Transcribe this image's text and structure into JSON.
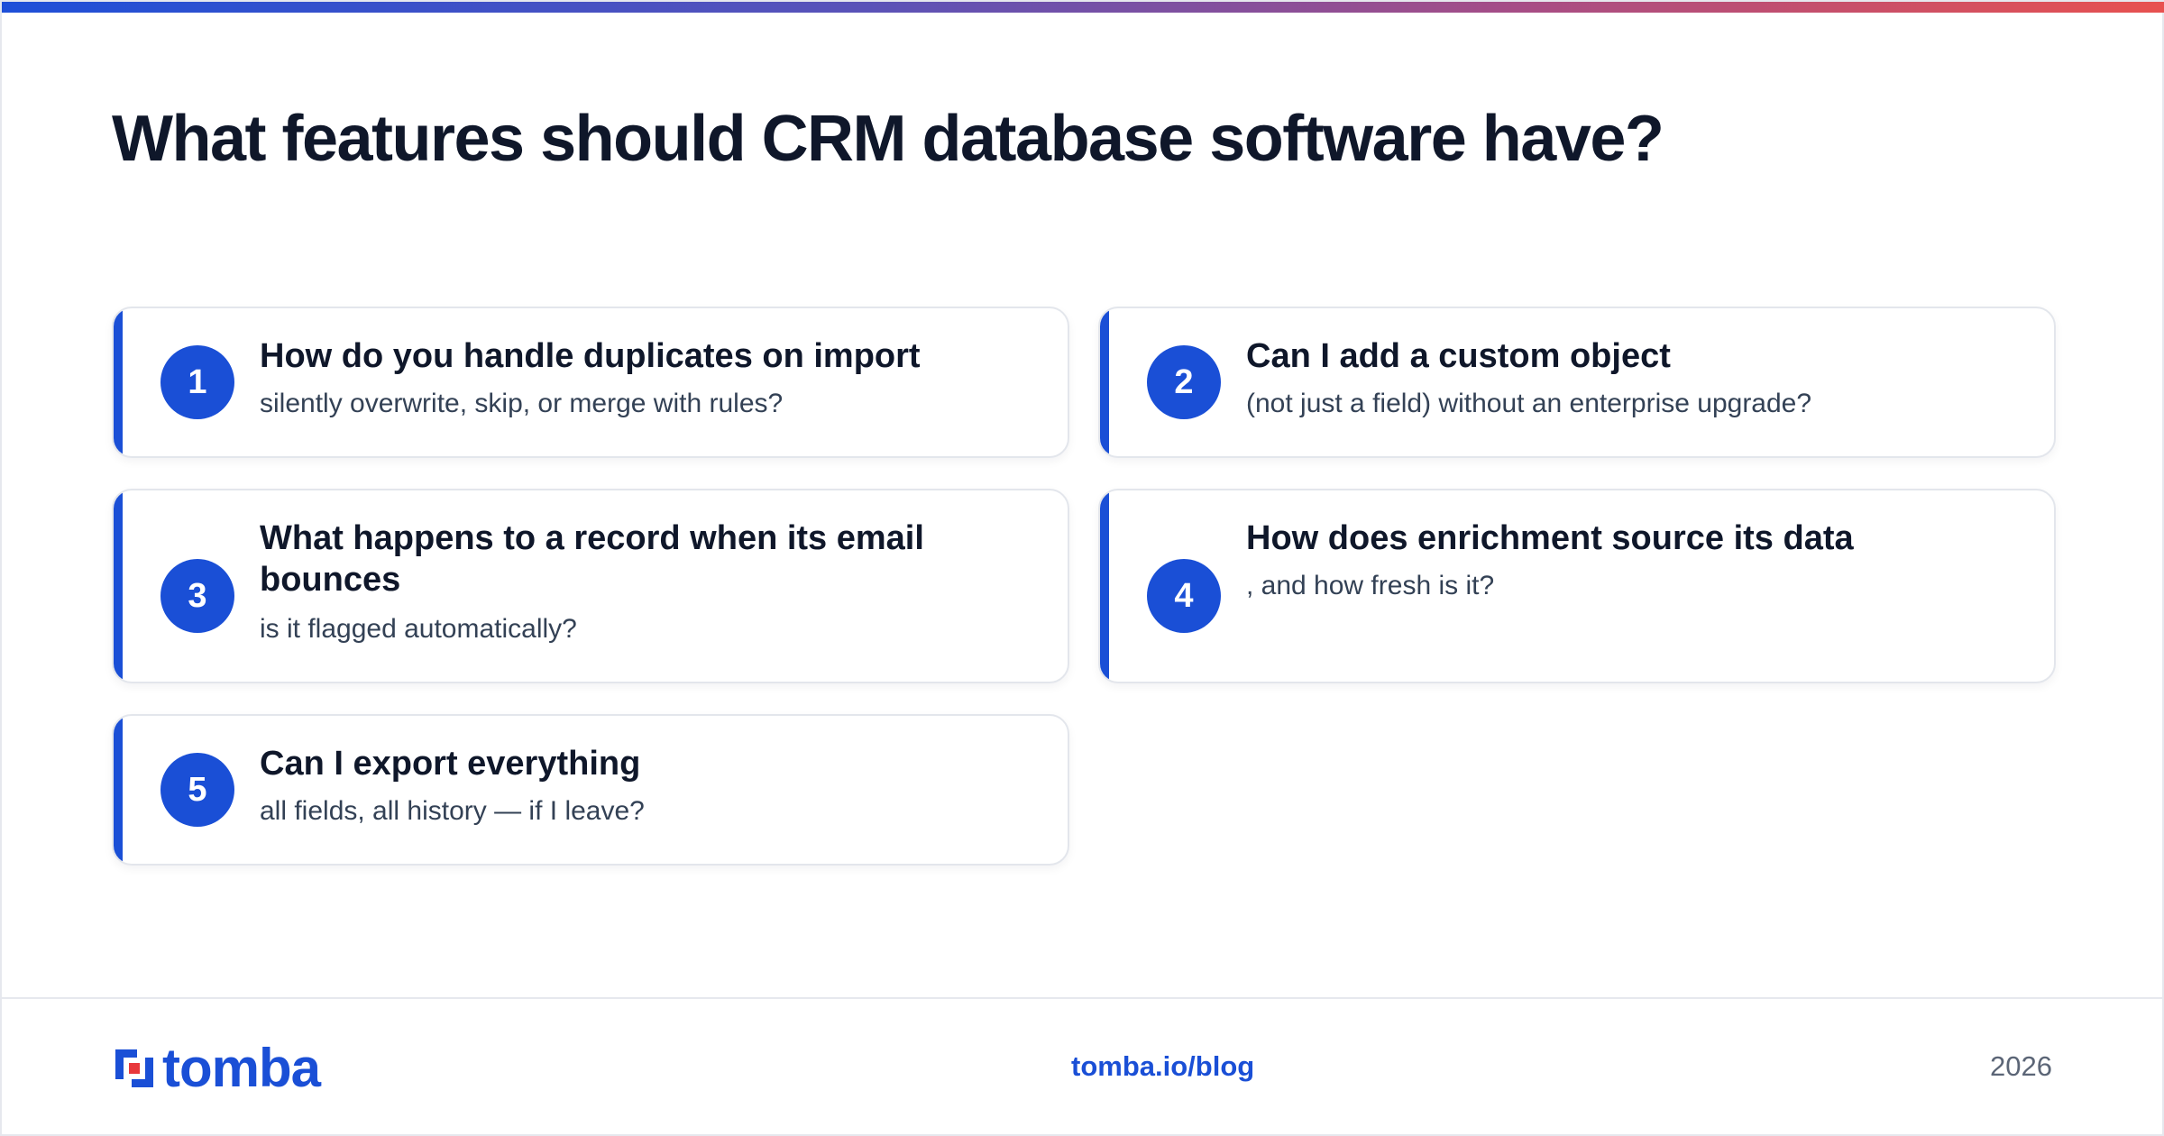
{
  "title": "What features should CRM database software have?",
  "cards": [
    {
      "number": "1",
      "title": "How do you handle duplicates on import",
      "subtitle": "silently overwrite, skip, or merge with rules?"
    },
    {
      "number": "2",
      "title": "Can I add a custom object",
      "subtitle": "(not just a field) without an enterprise upgrade?"
    },
    {
      "number": "3",
      "title": "What happens to a record when its email bounces",
      "subtitle": "is it flagged automatically?"
    },
    {
      "number": "4",
      "title": "How does enrichment source its data",
      "subtitle": ", and how fresh is it?"
    },
    {
      "number": "5",
      "title": "Can I export everything",
      "subtitle": "all fields, all history — if I leave?"
    }
  ],
  "footer": {
    "brand": "tomba",
    "link": "tomba.io/blog",
    "year": "2026"
  },
  "colors": {
    "accent": "#1a4fd6",
    "brand_red": "#e8383b",
    "title_text": "#0f172a"
  }
}
